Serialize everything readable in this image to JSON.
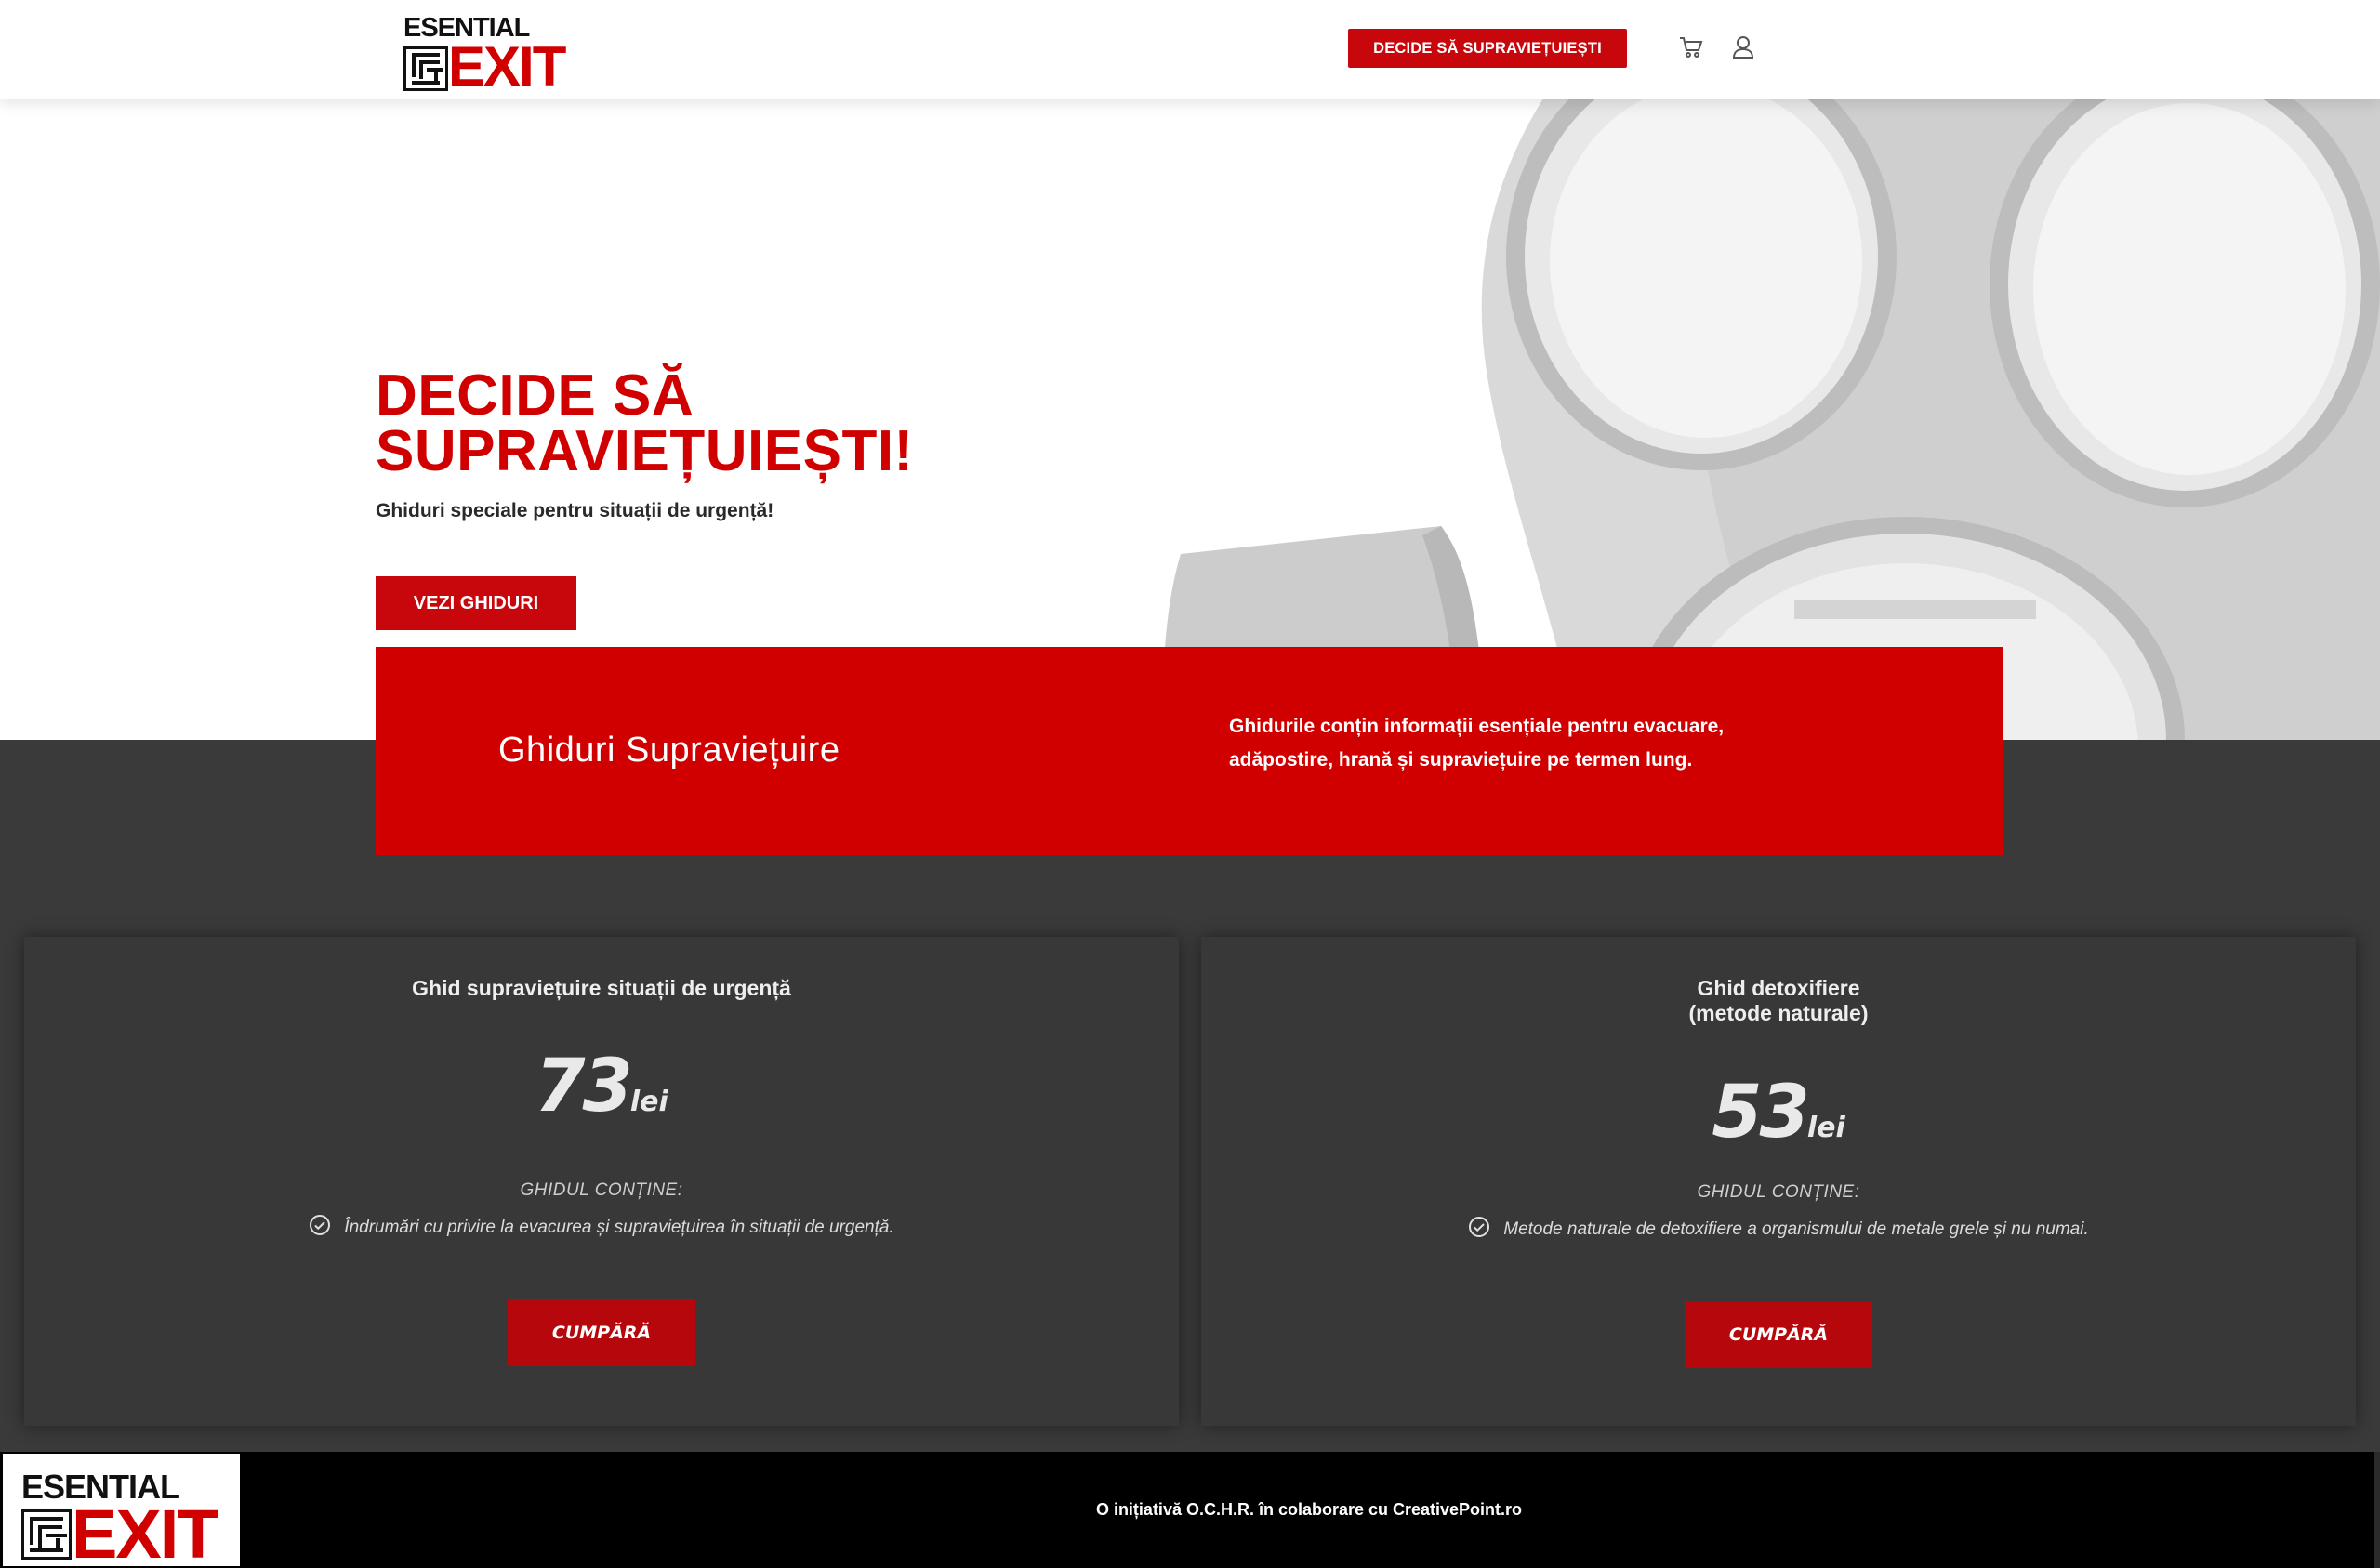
{
  "brand": {
    "logo_top": "ESENTIAL",
    "logo_main": "EXIT"
  },
  "header": {
    "cta_label": "DECIDE SĂ SUPRAVIEȚUIEȘTI",
    "icons": [
      "cart-icon",
      "user-icon"
    ]
  },
  "hero": {
    "title_line1": "DECIDE SĂ",
    "title_line2": "SUPRAVIEȚUIEȘTI!",
    "subtitle": "Ghiduri speciale pentru situații de urgență!",
    "button_label": "VEZI GHIDURI"
  },
  "band": {
    "title": "Ghiduri Supraviețuire",
    "text": "Ghidurile conțin informații esențiale pentru evacuare, adăpostire, hrană și supraviețuire pe termen lung."
  },
  "products": [
    {
      "title_line1": "Ghid supraviețuire situații de urgență",
      "title_line2": "",
      "price": "73",
      "currency": "lei",
      "contains_label": "GHIDUL CONȚINE:",
      "feature": "Îndrumări cu privire la evacurea și supraviețuirea în situații de urgență.",
      "buy_label": "CUMPĂRĂ"
    },
    {
      "title_line1": "Ghid detoxifiere",
      "title_line2": "(metode naturale)",
      "price": "53",
      "currency": "lei",
      "contains_label": "GHIDUL CONȚINE:",
      "feature": "Metode naturale de detoxifiere a organismului de metale grele și nu numai.",
      "buy_label": "CUMPĂRĂ"
    }
  ],
  "footer": {
    "text": "O inițiativă O.C.H.R. în colaborare cu CreativePoint.ro"
  },
  "colors": {
    "brand_red": "#d10000",
    "button_red": "#c8070d",
    "dark_bg": "#3a3a3a",
    "footer_bg": "#000000"
  }
}
